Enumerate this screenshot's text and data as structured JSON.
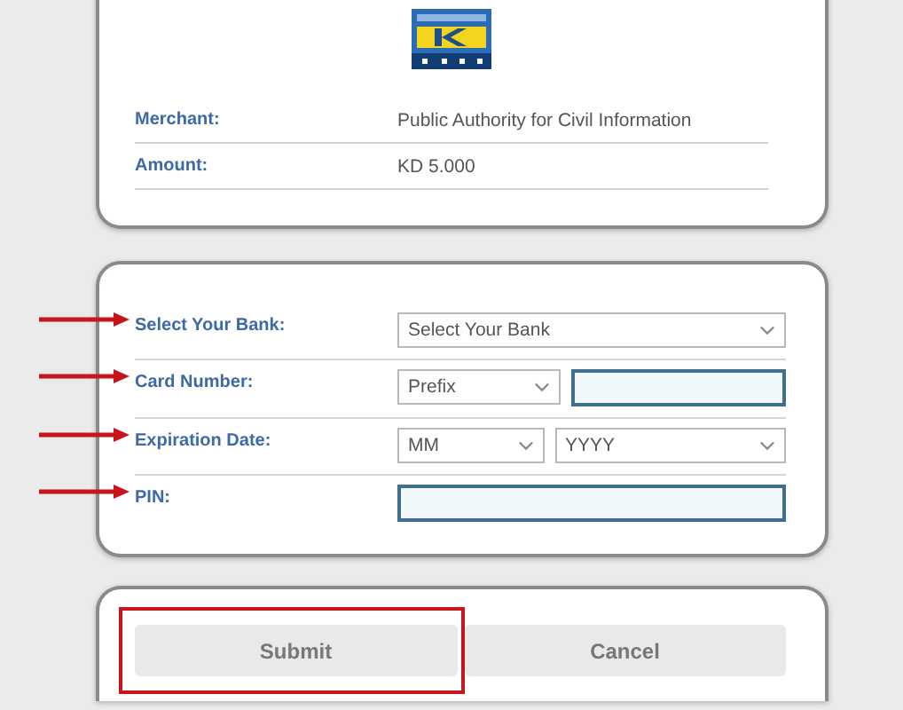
{
  "summary": {
    "rows": [
      {
        "label": "Merchant:",
        "value": "Public Authority for Civil Information"
      },
      {
        "label": "Amount:",
        "value": "KD 5.000"
      }
    ]
  },
  "form": {
    "rows": [
      {
        "label": "Select Your Bank:",
        "arrow": true,
        "controls": [
          {
            "kind": "select",
            "text": "Select Your Bank"
          }
        ]
      },
      {
        "label": "Card Number:",
        "arrow": true,
        "controls": [
          {
            "kind": "select",
            "text": "Prefix"
          },
          {
            "kind": "input"
          }
        ]
      },
      {
        "label": "Expiration Date:",
        "arrow": true,
        "controls": [
          {
            "kind": "select",
            "text": "MM"
          },
          {
            "kind": "select",
            "text": "YYYY"
          }
        ]
      },
      {
        "label": "PIN:",
        "arrow": true,
        "controls": [
          {
            "kind": "input"
          }
        ]
      }
    ]
  },
  "actions": {
    "buttons": [
      {
        "label": "Submit",
        "highlighted": true
      },
      {
        "label": "Cancel",
        "highlighted": false
      }
    ]
  }
}
